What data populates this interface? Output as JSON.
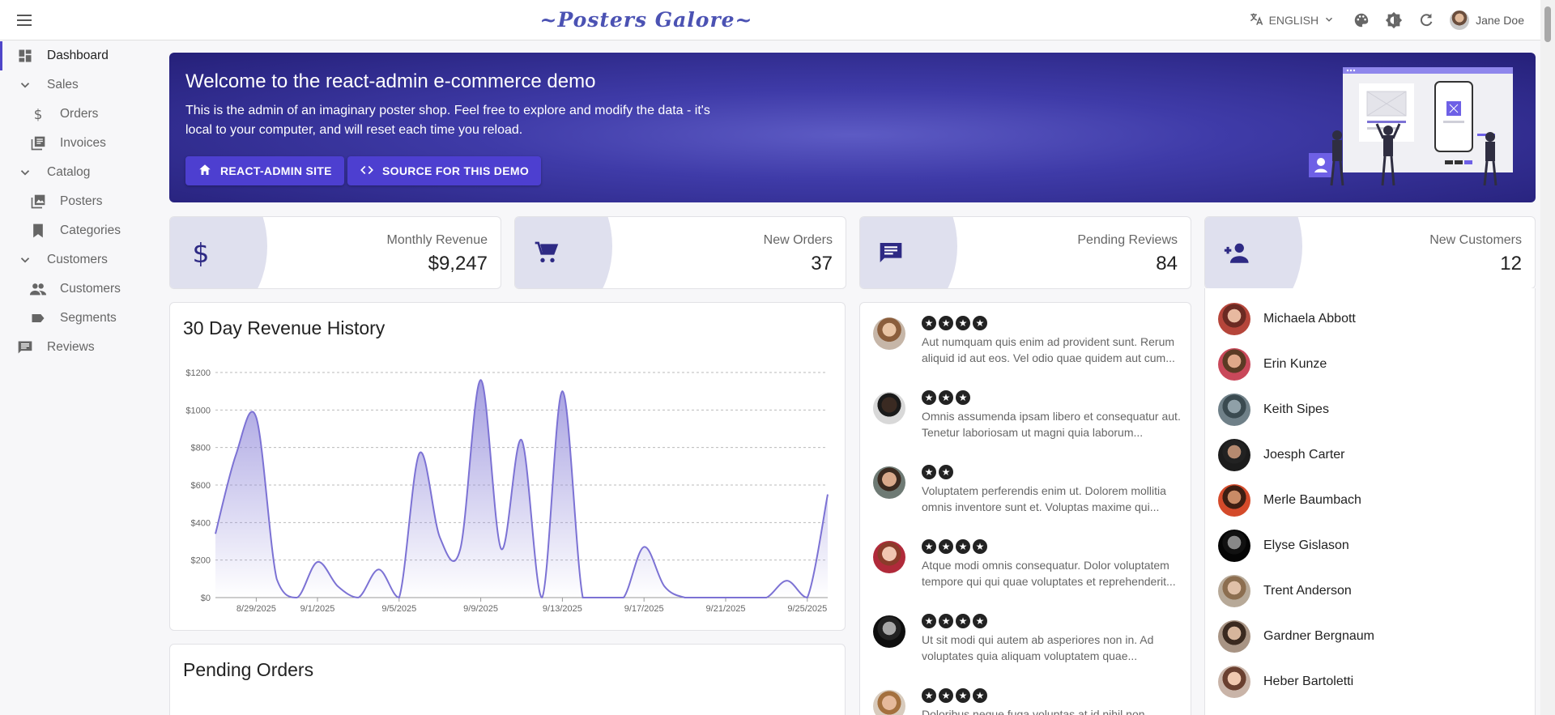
{
  "appbar": {
    "brand": "~Posters Galore~",
    "language": "ENGLISH",
    "user_name": "Jane Doe"
  },
  "sidebar": {
    "items": [
      {
        "label": "Dashboard",
        "icon": "dashboard-icon",
        "level": 0,
        "active": true
      },
      {
        "label": "Sales",
        "icon": "chevron-down-icon",
        "level": 0
      },
      {
        "label": "Orders",
        "icon": "dollar-icon",
        "level": 1
      },
      {
        "label": "Invoices",
        "icon": "library-books-icon",
        "level": 1
      },
      {
        "label": "Catalog",
        "icon": "chevron-down-icon",
        "level": 0
      },
      {
        "label": "Posters",
        "icon": "collections-icon",
        "level": 1
      },
      {
        "label": "Categories",
        "icon": "bookmark-icon",
        "level": 1
      },
      {
        "label": "Customers",
        "icon": "chevron-down-icon",
        "level": 0
      },
      {
        "label": "Customers",
        "icon": "people-icon",
        "level": 1
      },
      {
        "label": "Segments",
        "icon": "label-icon",
        "level": 1
      },
      {
        "label": "Reviews",
        "icon": "comment-icon",
        "level": 0
      }
    ]
  },
  "welcome": {
    "title": "Welcome to the react-admin e-commerce demo",
    "text": "This is the admin of an imaginary poster shop. Feel free to explore and modify the data - it's local to your computer, and will reset each time you reload.",
    "button1": "REACT-ADMIN SITE",
    "button2": "SOURCE FOR THIS DEMO"
  },
  "stats": {
    "revenue": {
      "label": "Monthly Revenue",
      "value": "$9,247"
    },
    "orders": {
      "label": "New Orders",
      "value": "37"
    },
    "reviews": {
      "label": "Pending Reviews",
      "value": "84"
    },
    "customers": {
      "label": "New Customers",
      "value": "12"
    }
  },
  "revenue_history": {
    "title": "30 Day Revenue History"
  },
  "pending_orders": {
    "title": "Pending Orders"
  },
  "reviews": [
    {
      "stars": 4,
      "text": "Aut numquam quis enim ad provident sunt. Rerum aliquid id aut eos. Vel odio quae quidem aut cum..."
    },
    {
      "stars": 3,
      "text": "Omnis assumenda ipsam libero et consequatur aut. Tenetur laboriosam ut magni quia laborum..."
    },
    {
      "stars": 2,
      "text": "Voluptatem perferendis enim ut. Dolorem mollitia omnis inventore sunt et. Voluptas maxime qui..."
    },
    {
      "stars": 4,
      "text": "Atque modi omnis consequatur. Dolor voluptatem tempore qui qui quae voluptates et reprehenderit..."
    },
    {
      "stars": 4,
      "text": "Ut sit modi qui autem ab asperiores non in. Ad voluptates quia aliquam voluptatem quae..."
    },
    {
      "stars": 4,
      "text": "Doloribus neque fuga voluptas at id nihil non"
    }
  ],
  "customers": [
    "Michaela Abbott",
    "Erin Kunze",
    "Keith Sipes",
    "Joesph Carter",
    "Merle Baumbach",
    "Elyse Gislason",
    "Trent Anderson",
    "Gardner Bergnaum",
    "Heber Bartoletti"
  ],
  "colors": {
    "accent": "#4f46c9",
    "banner_dark": "#252079",
    "line": "#7c72d4"
  },
  "chart_data": {
    "type": "area",
    "title": "30 Day Revenue History",
    "xlabel": "",
    "ylabel": "",
    "ylim": [
      0,
      1200
    ],
    "yticks": [
      "$0",
      "$200",
      "$400",
      "$600",
      "$800",
      "$1000",
      "$1200"
    ],
    "xticks": [
      "8/29/2025",
      "9/1/2025",
      "9/5/2025",
      "9/9/2025",
      "9/13/2025",
      "9/17/2025",
      "9/21/2025",
      "9/25/2025"
    ],
    "x": [
      "8/27/2025",
      "8/28/2025",
      "8/29/2025",
      "8/30/2025",
      "8/31/2025",
      "9/1/2025",
      "9/2/2025",
      "9/3/2025",
      "9/4/2025",
      "9/5/2025",
      "9/6/2025",
      "9/7/2025",
      "9/8/2025",
      "9/9/2025",
      "9/10/2025",
      "9/11/2025",
      "9/12/2025",
      "9/13/2025",
      "9/14/2025",
      "9/15/2025",
      "9/16/2025",
      "9/17/2025",
      "9/18/2025",
      "9/19/2025",
      "9/20/2025",
      "9/21/2025",
      "9/22/2025",
      "9/23/2025",
      "9/24/2025",
      "9/25/2025",
      "9/26/2025"
    ],
    "values": [
      340,
      760,
      960,
      100,
      0,
      190,
      60,
      0,
      150,
      0,
      770,
      320,
      260,
      1160,
      260,
      840,
      0,
      1100,
      0,
      0,
      0,
      270,
      60,
      0,
      0,
      0,
      0,
      0,
      90,
      0,
      550
    ],
    "grid": true,
    "legend": "none"
  }
}
